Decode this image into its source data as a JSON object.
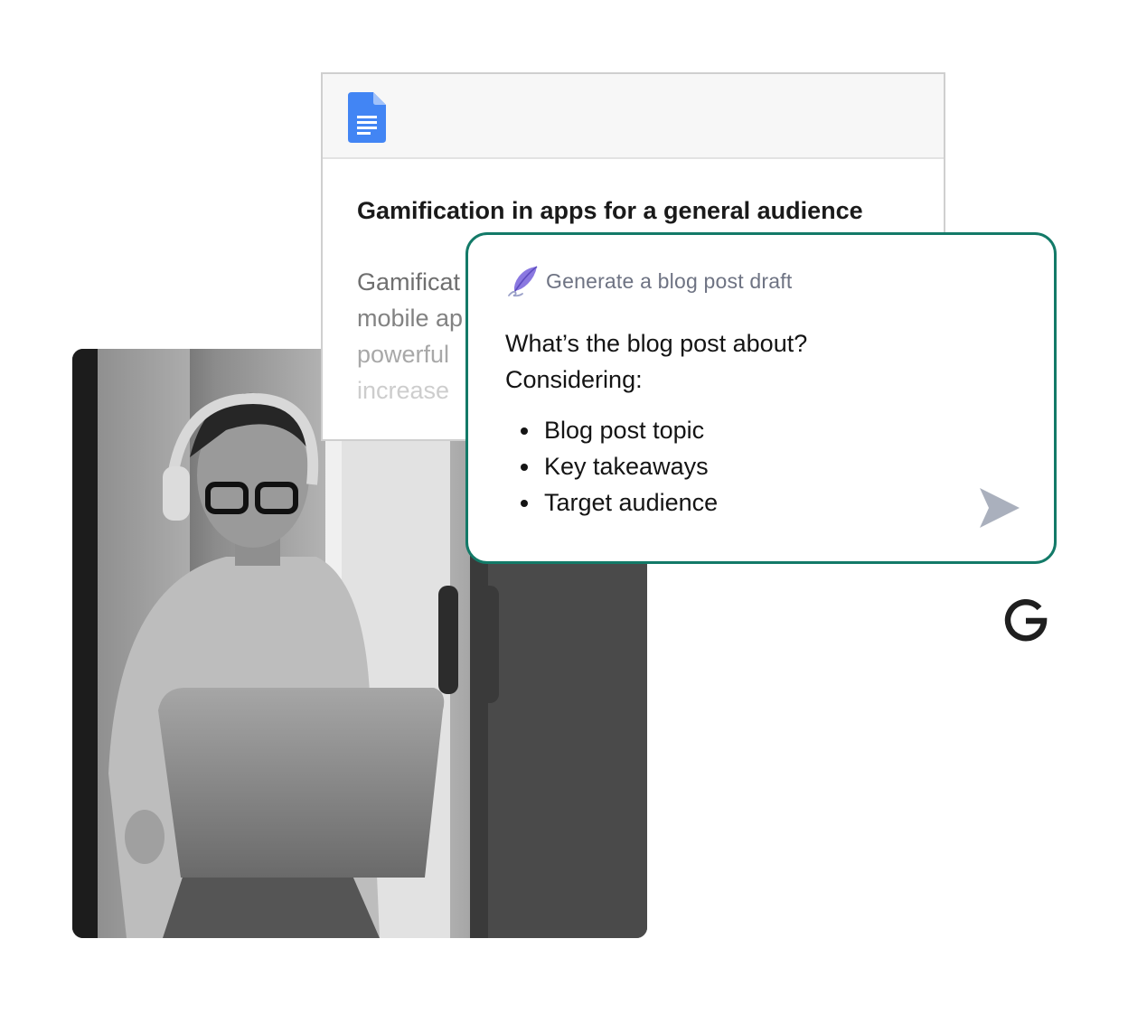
{
  "doc": {
    "title": "Gamification in apps for a general audience",
    "body_lines": [
      "Gamificat",
      "mobile ap",
      "powerful",
      "increase"
    ]
  },
  "ai_prompt": {
    "header_label": "Generate a blog post draft",
    "question_line1": "What’s the blog post about?",
    "question_line2": "Considering:",
    "bullets": [
      "Blog post topic",
      "Key takeaways",
      "Target audience"
    ]
  },
  "icons": {
    "doc": "google-docs-icon",
    "quill": "quill-pen-icon",
    "send": "send-icon",
    "brand": "google-g-logo"
  },
  "colors": {
    "card_border": "#137a68",
    "docs_blue": "#4285f4",
    "quill_purple": "#8a78e0",
    "send_gray": "#aab0bd"
  }
}
